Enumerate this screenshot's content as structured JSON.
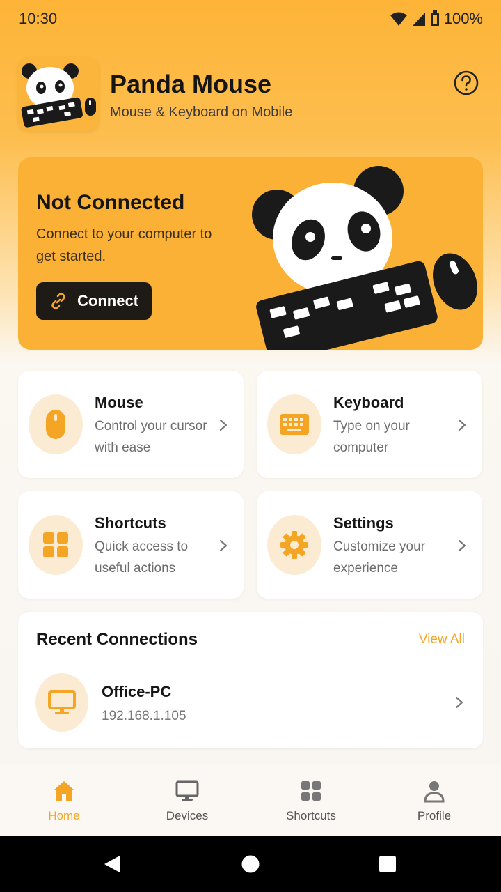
{
  "status_bar": {
    "time": "10:30",
    "battery": "100%"
  },
  "header": {
    "title": "Panda Mouse",
    "subtitle": "Mouse & Keyboard on Mobile"
  },
  "hero": {
    "title": "Not Connected",
    "text": "Connect to your computer to get started.",
    "connect_label": "Connect"
  },
  "features": [
    {
      "title": "Mouse",
      "desc": "Control your cursor with ease",
      "icon": "mouse-icon"
    },
    {
      "title": "Keyboard",
      "desc": "Type on your computer",
      "icon": "keyboard-icon"
    },
    {
      "title": "Shortcuts",
      "desc": "Quick access to useful actions",
      "icon": "grid-icon"
    },
    {
      "title": "Settings",
      "desc": "Customize your experience",
      "icon": "gear-icon"
    }
  ],
  "recent": {
    "title": "Recent Connections",
    "view_all": "View All",
    "devices": [
      {
        "name": "Office-PC",
        "ip": "192.168.1.105"
      }
    ]
  },
  "bottom_nav": [
    {
      "label": "Home",
      "active": true
    },
    {
      "label": "Devices",
      "active": false
    },
    {
      "label": "Shortcuts",
      "active": false
    },
    {
      "label": "Profile",
      "active": false
    }
  ],
  "colors": {
    "accent": "#F5A524",
    "hero_bg": "#FAB136",
    "dark": "#1E1A16"
  }
}
